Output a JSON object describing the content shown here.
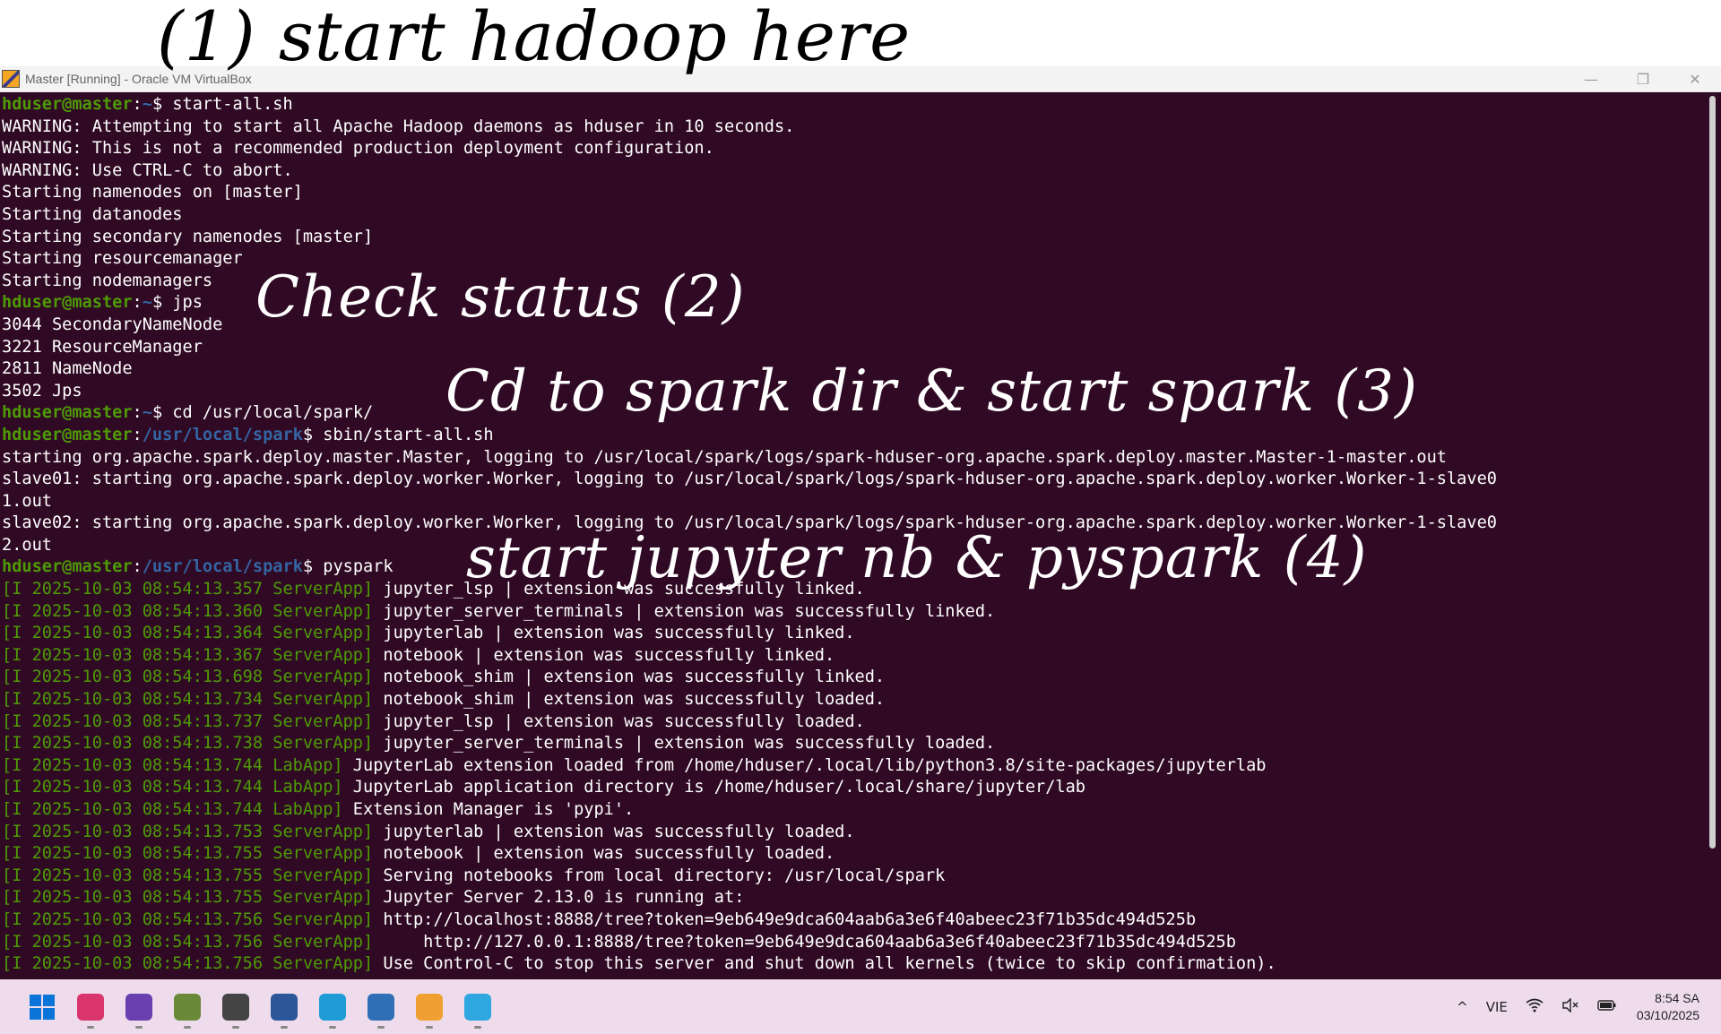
{
  "window": {
    "title": "Master [Running] - Oracle VM VirtualBox",
    "minimize_glyph": "—",
    "restore_glyph": "❐",
    "close_glyph": "✕"
  },
  "annotations": {
    "a1": "(1) start hadoop here",
    "a2": "Check status (2)",
    "a3": "Cd to spark dir & start spark (3)",
    "a4": "start jupyter nb & pyspark (4)"
  },
  "terminal": {
    "lines": [
      {
        "type": "prompt",
        "user": "hduser@master",
        "path": "~",
        "cmd": " start-all.sh"
      },
      {
        "type": "text",
        "text": "WARNING: Attempting to start all Apache Hadoop daemons as hduser in 10 seconds."
      },
      {
        "type": "text",
        "text": "WARNING: This is not a recommended production deployment configuration."
      },
      {
        "type": "text",
        "text": "WARNING: Use CTRL-C to abort."
      },
      {
        "type": "text",
        "text": "Starting namenodes on [master]"
      },
      {
        "type": "text",
        "text": "Starting datanodes"
      },
      {
        "type": "text",
        "text": "Starting secondary namenodes [master]"
      },
      {
        "type": "text",
        "text": "Starting resourcemanager"
      },
      {
        "type": "text",
        "text": "Starting nodemanagers"
      },
      {
        "type": "prompt",
        "user": "hduser@master",
        "path": "~",
        "cmd": " jps"
      },
      {
        "type": "text",
        "text": "3044 SecondaryNameNode"
      },
      {
        "type": "text",
        "text": "3221 ResourceManager"
      },
      {
        "type": "text",
        "text": "2811 NameNode"
      },
      {
        "type": "text",
        "text": "3502 Jps"
      },
      {
        "type": "prompt",
        "user": "hduser@master",
        "path": "~",
        "cmd": " cd /usr/local/spark/"
      },
      {
        "type": "prompt",
        "user": "hduser@master",
        "path": "/usr/local/spark",
        "cmd": " sbin/start-all.sh"
      },
      {
        "type": "text",
        "text": "starting org.apache.spark.deploy.master.Master, logging to /usr/local/spark/logs/spark-hduser-org.apache.spark.deploy.master.Master-1-master.out"
      },
      {
        "type": "text",
        "text": "slave01: starting org.apache.spark.deploy.worker.Worker, logging to /usr/local/spark/logs/spark-hduser-org.apache.spark.deploy.worker.Worker-1-slave0"
      },
      {
        "type": "text",
        "text": "1.out"
      },
      {
        "type": "text",
        "text": "slave02: starting org.apache.spark.deploy.worker.Worker, logging to /usr/local/spark/logs/spark-hduser-org.apache.spark.deploy.worker.Worker-1-slave0"
      },
      {
        "type": "text",
        "text": "2.out"
      },
      {
        "type": "prompt",
        "user": "hduser@master",
        "path": "/usr/local/spark",
        "cmd": " pyspark"
      },
      {
        "type": "log",
        "tag": "[I 2025-10-03 08:54:13.357 ServerApp]",
        "text": " jupyter_lsp | extension was successfully linked."
      },
      {
        "type": "log",
        "tag": "[I 2025-10-03 08:54:13.360 ServerApp]",
        "text": " jupyter_server_terminals | extension was successfully linked."
      },
      {
        "type": "log",
        "tag": "[I 2025-10-03 08:54:13.364 ServerApp]",
        "text": " jupyterlab | extension was successfully linked."
      },
      {
        "type": "log",
        "tag": "[I 2025-10-03 08:54:13.367 ServerApp]",
        "text": " notebook | extension was successfully linked."
      },
      {
        "type": "log",
        "tag": "[I 2025-10-03 08:54:13.698 ServerApp]",
        "text": " notebook_shim | extension was successfully linked."
      },
      {
        "type": "log",
        "tag": "[I 2025-10-03 08:54:13.734 ServerApp]",
        "text": " notebook_shim | extension was successfully loaded."
      },
      {
        "type": "log",
        "tag": "[I 2025-10-03 08:54:13.737 ServerApp]",
        "text": " jupyter_lsp | extension was successfully loaded."
      },
      {
        "type": "log",
        "tag": "[I 2025-10-03 08:54:13.738 ServerApp]",
        "text": " jupyter_server_terminals | extension was successfully loaded."
      },
      {
        "type": "log",
        "tag": "[I 2025-10-03 08:54:13.744 LabApp]",
        "text": " JupyterLab extension loaded from /home/hduser/.local/lib/python3.8/site-packages/jupyterlab"
      },
      {
        "type": "log",
        "tag": "[I 2025-10-03 08:54:13.744 LabApp]",
        "text": " JupyterLab application directory is /home/hduser/.local/share/jupyter/lab"
      },
      {
        "type": "log",
        "tag": "[I 2025-10-03 08:54:13.744 LabApp]",
        "text": " Extension Manager is 'pypi'."
      },
      {
        "type": "log",
        "tag": "[I 2025-10-03 08:54:13.753 ServerApp]",
        "text": " jupyterlab | extension was successfully loaded."
      },
      {
        "type": "log",
        "tag": "[I 2025-10-03 08:54:13.755 ServerApp]",
        "text": " notebook | extension was successfully loaded."
      },
      {
        "type": "log",
        "tag": "[I 2025-10-03 08:54:13.755 ServerApp]",
        "text": " Serving notebooks from local directory: /usr/local/spark"
      },
      {
        "type": "log",
        "tag": "[I 2025-10-03 08:54:13.755 ServerApp]",
        "text": " Jupyter Server 2.13.0 is running at:"
      },
      {
        "type": "log",
        "tag": "[I 2025-10-03 08:54:13.756 ServerApp]",
        "text": " http://localhost:8888/tree?token=9eb649e9dca604aab6a3e6f40abeec23f71b35dc494d525b"
      },
      {
        "type": "log",
        "tag": "[I 2025-10-03 08:54:13.756 ServerApp]",
        "text": "     http://127.0.0.1:8888/tree?token=9eb649e9dca604aab6a3e6f40abeec23f71b35dc494d525b"
      },
      {
        "type": "log",
        "tag": "[I 2025-10-03 08:54:13.756 ServerApp]",
        "text": " Use Control-C to stop this server and shut down all kernels (twice to skip confirmation)."
      }
    ]
  },
  "taskbar": {
    "apps": [
      {
        "name": "windows-start-icon",
        "color": "#0a74d9"
      },
      {
        "name": "browser-app-icon",
        "color": "#d9346b"
      },
      {
        "name": "purple-app-icon",
        "color": "#6a3fb0"
      },
      {
        "name": "game-app-icon",
        "color": "#6a8a3a"
      },
      {
        "name": "cube-app-icon",
        "color": "#444444"
      },
      {
        "name": "word-app-icon",
        "color": "#2b579a"
      },
      {
        "name": "edge-app-icon",
        "color": "#1f9bd6"
      },
      {
        "name": "virtualbox-app-icon",
        "color": "#2f6fb5"
      },
      {
        "name": "virtualbox-vm-app-icon",
        "color": "#f0a030"
      },
      {
        "name": "notepad-app-icon",
        "color": "#2ea7e0"
      }
    ],
    "tray": {
      "chevron": "^",
      "language": "VIE",
      "time": "8:54 SA",
      "date": "03/10/2025"
    }
  }
}
